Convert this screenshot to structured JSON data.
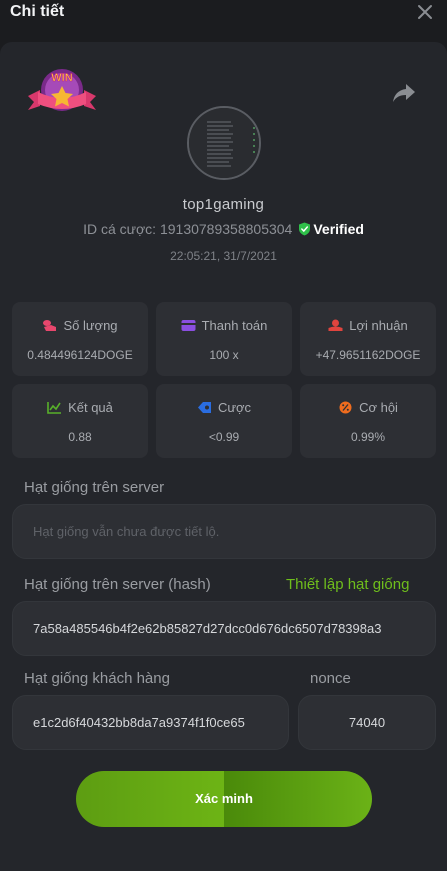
{
  "header": {
    "title": "Chi tiết"
  },
  "profile": {
    "username": "top1gaming",
    "bet_id_label": "ID cá cược:",
    "bet_id": "1913078935880530​4",
    "verified": "Verified",
    "timestamp": "22:05:21, 31/7/2021"
  },
  "stats": [
    {
      "label": "Số lượng",
      "value": "0.484496124DOGE",
      "icon": "coins-icon",
      "color": "#e8476d"
    },
    {
      "label": "Thanh toán",
      "value": "100 x",
      "icon": "card-icon",
      "color": "#8b4fe0"
    },
    {
      "label": "Lợi nhuận",
      "value": "+47.9651162DOGE",
      "icon": "profit-icon",
      "color": "#e0443e"
    },
    {
      "label": "Kết quả",
      "value": "0.88",
      "icon": "chart-icon",
      "color": "#58b12a"
    },
    {
      "label": "Cược",
      "value": "<0.99",
      "icon": "tag-icon",
      "color": "#2a6de0"
    },
    {
      "label": "Cơ hội",
      "value": "0.99%",
      "icon": "percent-icon",
      "color": "#ef6c1e"
    }
  ],
  "server_seed": {
    "label": "Hạt giống trên server",
    "placeholder": "Hạt giống vẫn chưa được tiết lộ."
  },
  "server_hash": {
    "label": "Hạt giống trên server (hash)",
    "link": "Thiết lập hạt giống",
    "value": "7a58a485546b4f2e62b85827d27dcc0d676dc6507d78398a3"
  },
  "client_seed": {
    "label": "Hạt giống khách hàng",
    "value": "e1c2d6f40432bb8da7a9374f1f0ce65"
  },
  "nonce": {
    "label": "nonce",
    "value": "74040"
  },
  "verify_button": {
    "label": "Xác minh"
  }
}
